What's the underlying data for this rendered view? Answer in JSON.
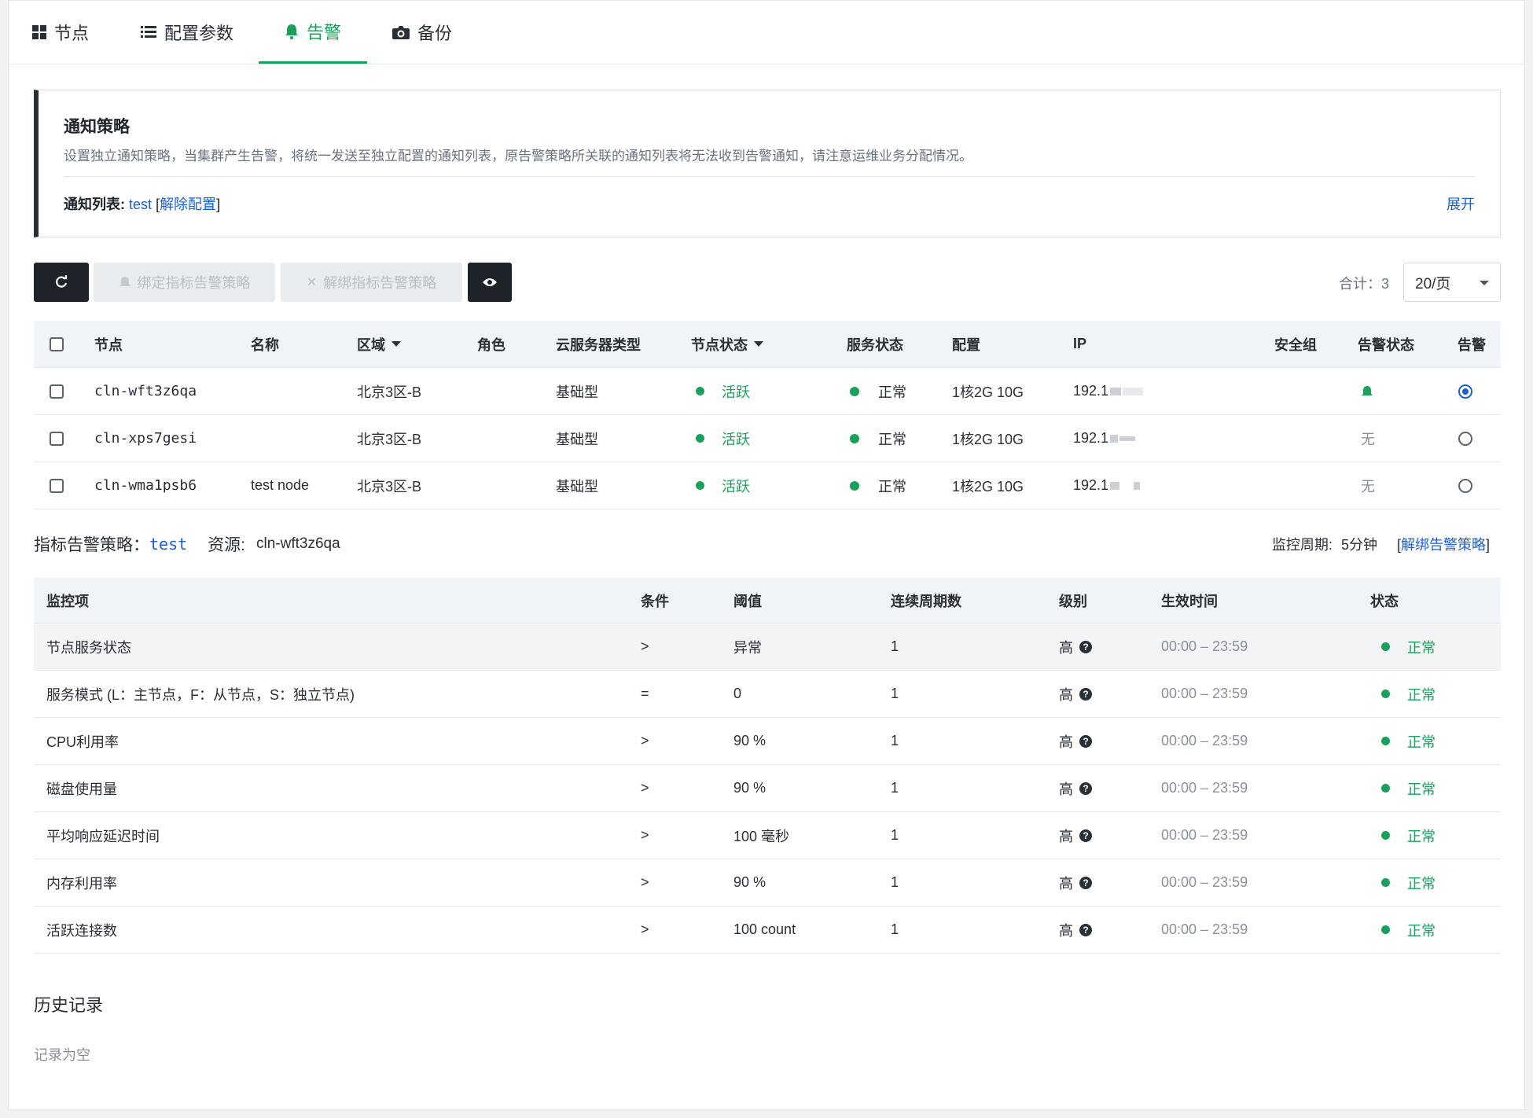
{
  "tabs": [
    {
      "label": "节点",
      "icon": "grid-icon",
      "active": false
    },
    {
      "label": "配置参数",
      "icon": "list-icon",
      "active": false
    },
    {
      "label": "告警",
      "icon": "bell-icon",
      "active": true
    },
    {
      "label": "备份",
      "icon": "camera-icon",
      "active": false
    }
  ],
  "notice": {
    "title": "通知策略",
    "description": "设置独立通知策略，当集群产生告警，将统一发送至独立配置的通知列表，原告警策略所关联的通知列表将无法收到告警通知，请注意运维业务分配情况。",
    "list_label": "通知列表:",
    "list_value": "test",
    "unbind_open": "[",
    "unbind_label": "解除配置",
    "unbind_close": "]",
    "expand_label": "展开"
  },
  "toolbar": {
    "bind_label": "绑定指标告警策略",
    "unbind_label": "解绑指标告警策略",
    "total_label": "合计：3",
    "page_size": "20/页"
  },
  "node_table": {
    "headers": {
      "node": "节点",
      "name": "名称",
      "zone": "区域",
      "role": "角色",
      "instance_type": "云服务器类型",
      "node_status": "节点状态",
      "service_status": "服务状态",
      "config": "配置",
      "ip": "IP",
      "security_group": "安全组",
      "alert_status": "告警状态",
      "alert": "告警"
    },
    "rows": [
      {
        "node": "cln-wft3z6qa",
        "name": "",
        "zone": "北京3区-B",
        "role": "",
        "instance_type": "基础型",
        "node_status": "活跃",
        "service_status": "正常",
        "config": "1核2G 10G",
        "ip": "192.1",
        "alert_status": "",
        "alert_selected": true
      },
      {
        "node": "cln-xps7gesi",
        "name": "",
        "zone": "北京3区-B",
        "role": "",
        "instance_type": "基础型",
        "node_status": "活跃",
        "service_status": "正常",
        "config": "1核2G 10G",
        "ip": "192.1",
        "alert_status": "无",
        "alert_selected": false
      },
      {
        "node": "cln-wma1psb6",
        "name": "test node",
        "zone": "北京3区-B",
        "role": "",
        "instance_type": "基础型",
        "node_status": "活跃",
        "service_status": "正常",
        "config": "1核2G 10G",
        "ip": "192.1",
        "alert_status": "无",
        "alert_selected": false
      }
    ]
  },
  "policy": {
    "label": "指标告警策略：",
    "name": "test",
    "resource_label": "资源:",
    "resource_value": "cln-wft3z6qa",
    "period_label": "监控周期:",
    "period_value": "5分钟",
    "unbind_open": "[",
    "unbind_label": "解绑告警策略",
    "unbind_close": "]"
  },
  "metric_table": {
    "headers": {
      "item": "监控项",
      "condition": "条件",
      "threshold": "阈值",
      "periods": "连续周期数",
      "level": "级别",
      "effective": "生效时间",
      "status": "状态"
    },
    "rows": [
      {
        "item": "节点服务状态",
        "condition": ">",
        "threshold": "异常",
        "periods": "1",
        "level": "高",
        "effective": "00:00 – 23:59",
        "status": "正常"
      },
      {
        "item": "服务模式 (L：主节点，F：从节点，S：独立节点)",
        "condition": "=",
        "threshold": "0",
        "periods": "1",
        "level": "高",
        "effective": "00:00 – 23:59",
        "status": "正常"
      },
      {
        "item": "CPU利用率",
        "condition": ">",
        "threshold": "90 %",
        "periods": "1",
        "level": "高",
        "effective": "00:00 – 23:59",
        "status": "正常"
      },
      {
        "item": "磁盘使用量",
        "condition": ">",
        "threshold": "90 %",
        "periods": "1",
        "level": "高",
        "effective": "00:00 – 23:59",
        "status": "正常"
      },
      {
        "item": "平均响应延迟时间",
        "condition": ">",
        "threshold": "100 毫秒",
        "periods": "1",
        "level": "高",
        "effective": "00:00 – 23:59",
        "status": "正常"
      },
      {
        "item": "内存利用率",
        "condition": ">",
        "threshold": "90 %",
        "periods": "1",
        "level": "高",
        "effective": "00:00 – 23:59",
        "status": "正常"
      },
      {
        "item": "活跃连接数",
        "condition": ">",
        "threshold": "100 count",
        "periods": "1",
        "level": "高",
        "effective": "00:00 – 23:59",
        "status": "正常"
      }
    ]
  },
  "history": {
    "title": "历史记录",
    "empty": "记录为空"
  },
  "colors": {
    "accent_green": "#19a05a",
    "link_blue": "#1d5fd1",
    "dark_button": "#1e2329"
  }
}
